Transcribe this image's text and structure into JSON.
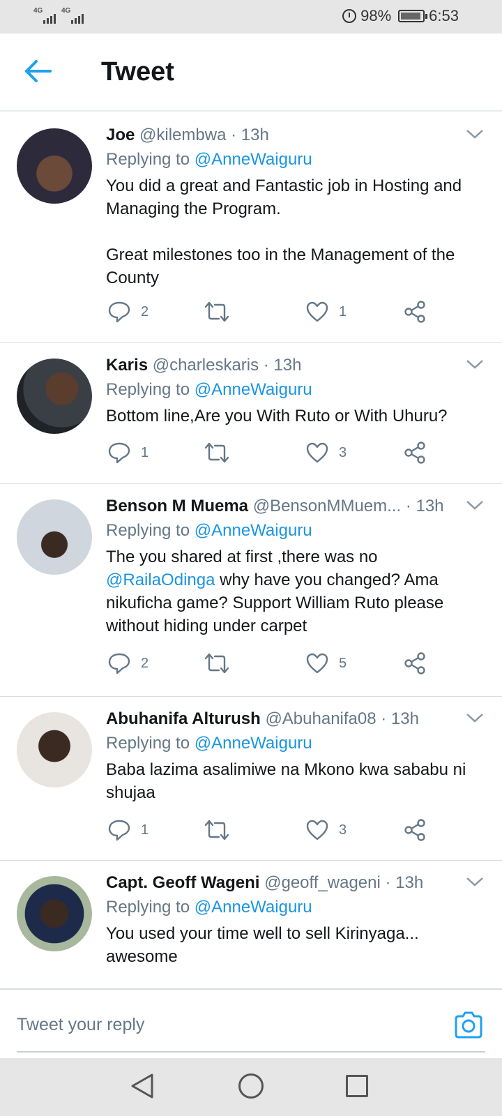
{
  "status": {
    "signal1": "4G",
    "signal2": "4G",
    "battery": "98%",
    "time": "6:53"
  },
  "header": {
    "title": "Tweet"
  },
  "tweets": [
    {
      "name": "Joe",
      "handle": "@kilembwa",
      "time": "· 13h",
      "replying_prefix": "Replying to ",
      "replying_to": "@AnneWaiguru",
      "text": "You did a great and Fantastic job in Hosting and Managing the Program.\n\nGreat milestones too in the Management of the County",
      "replies": "2",
      "likes": "1"
    },
    {
      "name": "Karis",
      "handle": "@charleskaris",
      "time": "· 13h",
      "replying_prefix": "Replying to ",
      "replying_to": "@AnneWaiguru",
      "text": "Bottom line,Are you With Ruto or With Uhuru?",
      "replies": "1",
      "likes": "3"
    },
    {
      "name": "Benson M Muema",
      "handle": "@BensonMMuem...",
      "time": "· 13h",
      "replying_prefix": "Replying to ",
      "replying_to": "@AnneWaiguru",
      "text_a": "The you shared at first ,there was no ",
      "mention": "@RailaOdinga",
      "text_b": " why have you changed? Ama nikuficha game? Support William Ruto please without hiding under carpet",
      "replies": "2",
      "likes": "5"
    },
    {
      "name": "Abuhanifa Alturush",
      "handle": "@Abuhanifa08",
      "time": "· 13h",
      "replying_prefix": "Replying to ",
      "replying_to": "@AnneWaiguru",
      "text": "Baba lazima asalimiwe na Mkono kwa sababu ni shujaa",
      "replies": "1",
      "likes": "3"
    },
    {
      "name": "Capt. Geoff Wageni",
      "handle": "@geoff_wageni",
      "time": "· 13h",
      "replying_prefix": "Replying to ",
      "replying_to": "@AnneWaiguru",
      "text": "You used your time well to sell Kirinyaga... awesome"
    }
  ],
  "reply_bar": {
    "placeholder": "Tweet your reply"
  },
  "colors": {
    "accent": "#1b95e0",
    "text": "#14171a",
    "muted": "#657786"
  },
  "icons": [
    "back-arrow-icon",
    "chevron-down-icon",
    "reply-icon",
    "retweet-icon",
    "like-icon",
    "share-icon",
    "camera-icon"
  ]
}
